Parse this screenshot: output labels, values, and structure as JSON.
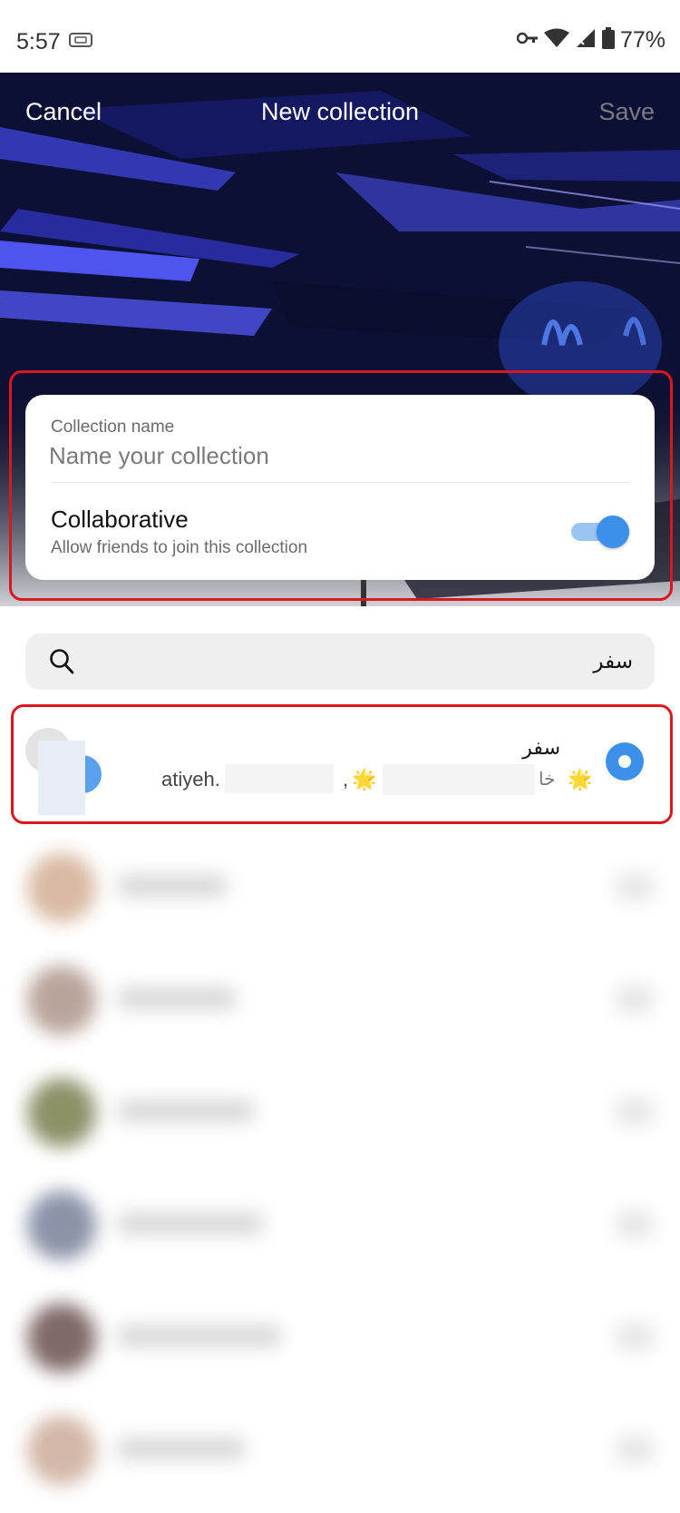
{
  "status_bar": {
    "time": "5:57",
    "battery": "77%",
    "icons": [
      "cast-icon",
      "vpn-key-icon",
      "wifi-icon",
      "signal-icon",
      "battery-icon"
    ]
  },
  "nav": {
    "cancel_label": "Cancel",
    "title": "New collection",
    "save_label": "Save"
  },
  "form": {
    "name_label": "Collection name",
    "name_placeholder": "Name your collection",
    "name_value": "",
    "collab_title": "Collaborative",
    "collab_subtitle": "Allow friends to join this collection",
    "collab_enabled": true
  },
  "search": {
    "value": "سفر",
    "icon": "search-icon"
  },
  "result": {
    "title": "سفر",
    "subtitle_user": "atiyeh.",
    "subtitle_comma": ",",
    "subtitle_star": "🌟",
    "subtitle_rtl": "خا",
    "selected": true
  },
  "colors": {
    "accent": "#3b90ea",
    "highlight": "#d8181f",
    "save_disabled": "#7a7a80"
  },
  "blurred_rows": [
    {
      "avatar_color": "#d9b9a3"
    },
    {
      "avatar_color": "#b8a49a"
    },
    {
      "avatar_color": "#8d9168"
    },
    {
      "avatar_color": "#8b93a8"
    },
    {
      "avatar_color": "#7f6a68"
    },
    {
      "avatar_color": "#d3b7a8"
    }
  ]
}
